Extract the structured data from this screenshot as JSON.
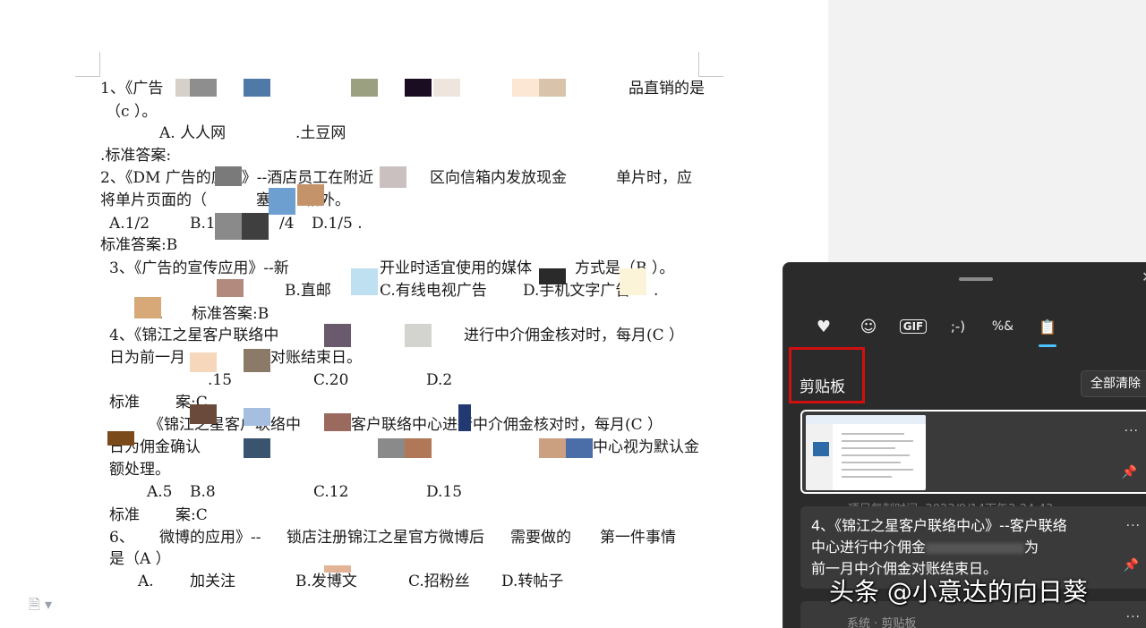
{
  "document": {
    "lines": [
      "1、《广告",
      "品直销的是",
      "（c ）。",
      "A. 人人网",
      ".土豆网",
      ".标准答案:",
      "2、《DM 广告的应用》--酒店员工在附近",
      "区向信箱内发放现金",
      "单片时，应",
      "将单片页面的（",
      "塞",
      "箱外。",
      "A.1/2",
      "B.1/",
      "/4",
      "D.1/5 .",
      "标准答案:B",
      "3、《广告的宣传应用》--新",
      "开业时适宜使用的媒体",
      "方式是（B ）。",
      "B.直邮",
      "C.有线电视广告",
      "D.手机文字广告",
      ".",
      "D.",
      "标准答案:B",
      "4、《锦江之星客户联络中",
      "进行中介佣金核对时，每月(C ）",
      "日为前一月",
      "对账结束日。",
      ".15",
      "C.20",
      "D.2",
      "标准",
      "案:C",
      "《锦江之星客户联络中",
      "客户联络中心进行中介佣金核对时，每月(C ）",
      "日为佣金确认",
      "中心视为默认金",
      "额处理。",
      "A.5",
      "B.8",
      "C.12",
      "D.15",
      "标准",
      "案:C",
      "6、",
      "微博的应用》--",
      "锁店注册锦江之星官方微博后",
      "需要做的",
      "第一件事情",
      "是（A ）",
      "A.",
      "加关注",
      "B.发博文",
      "C.招粉丝",
      "D.转帖子"
    ]
  },
  "icons": {
    "doc_status": "document-icon"
  },
  "clipboard": {
    "tabs": [
      {
        "name": "sticker-icon",
        "glyph": "♥"
      },
      {
        "name": "emoji-icon",
        "glyph": "☺"
      },
      {
        "name": "gif-icon",
        "glyph": "GIF"
      },
      {
        "name": "kaomoji-icon",
        "glyph": ";-)"
      },
      {
        "name": "symbols-icon",
        "glyph": "%&"
      },
      {
        "name": "clipboard-icon",
        "glyph": "📋"
      }
    ],
    "title": "剪贴板",
    "clear_all": "全部清除",
    "more": "···",
    "pin": "📌",
    "copy_time": "项目复制时间: 2023/9/14下午2:24:43",
    "item2_text": "4、《锦江之星客户联络中心》--客户联络中心进行中介佣金核对时，每月为前一月中介佣金对账结束日。",
    "item2_line1": "4、《锦江之星客户联络中心》--客户联络",
    "item2_line2a": "中心进行中介佣金",
    "item2_line2b": "为",
    "item2_line3": "前一月中介佣金对账结束日。",
    "item3_text": "系统 · 剪贴板"
  },
  "watermark": "头条 @小意达的向日葵",
  "colors": {
    "panel_bg": "#2b2b2b",
    "card_bg": "#3a3a3a",
    "accent": "#4cc2ff",
    "highlight_box": "#d01010"
  }
}
